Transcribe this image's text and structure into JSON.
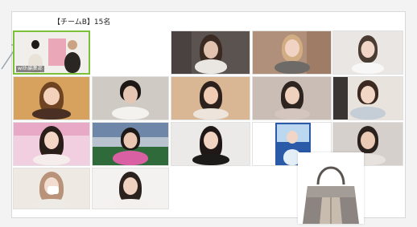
{
  "meeting": {
    "title": "【チームB】15名"
  },
  "participants": [
    {
      "id": "p1",
      "label": "with編集部"
    },
    {
      "id": "p2",
      "label": ""
    },
    {
      "id": "p3",
      "label": ""
    },
    {
      "id": "p4",
      "label": ""
    },
    {
      "id": "p5",
      "label": ""
    },
    {
      "id": "p6",
      "label": ""
    },
    {
      "id": "p7",
      "label": ""
    },
    {
      "id": "p8",
      "label": ""
    },
    {
      "id": "p9",
      "label": ""
    },
    {
      "id": "p10",
      "label": ""
    },
    {
      "id": "p11",
      "label": ""
    },
    {
      "id": "p12",
      "label": ""
    },
    {
      "id": "p13",
      "label": ""
    },
    {
      "id": "p14",
      "label": ""
    },
    {
      "id": "p15",
      "label": ""
    },
    {
      "id": "p16",
      "label": ""
    },
    {
      "id": "p17",
      "label": ""
    }
  ],
  "colors": {
    "active_speaker": "#7bbf3b"
  },
  "overlay": {
    "icon": "handbag-icon"
  }
}
